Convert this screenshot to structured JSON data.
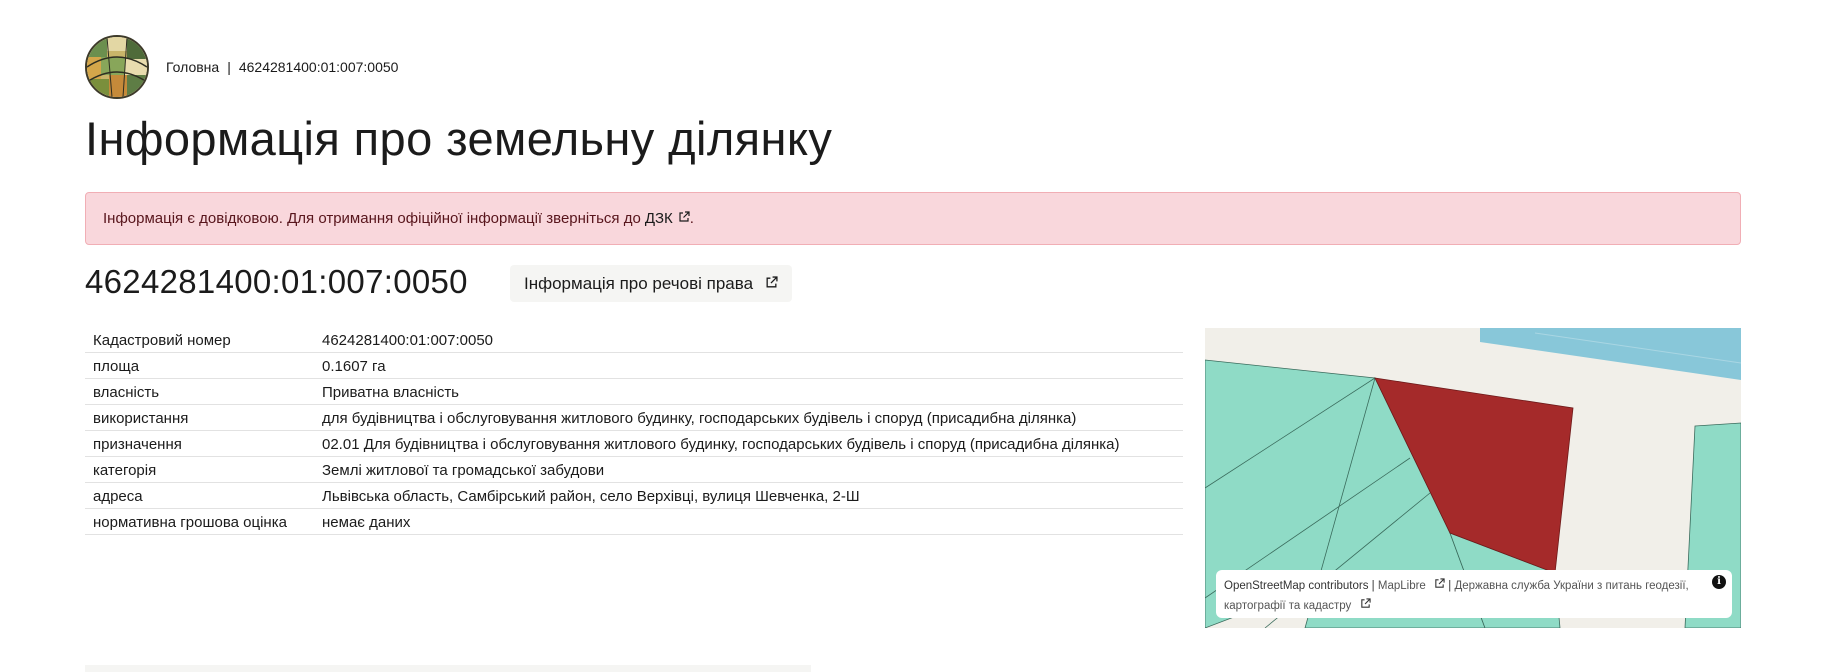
{
  "breadcrumb": {
    "home": "Головна",
    "separator": "|",
    "current": "4624281400:01:007:0050"
  },
  "page_title": "Інформація про земельну ділянку",
  "alert": {
    "text": "Інформація є довідковою. Для отримання офіційної інформації зверніться до",
    "link": "ДЗК",
    "suffix": "."
  },
  "parcel": {
    "number": "4624281400:01:007:0050",
    "rights_button": "Інформація про речові права"
  },
  "table": [
    {
      "label": "Кадастровий номер",
      "value": "4624281400:01:007:0050"
    },
    {
      "label": "площа",
      "value": "0.1607 га"
    },
    {
      "label": "власність",
      "value": "Приватна власність"
    },
    {
      "label": "використання",
      "value": "для будівництва і обслуговування житлового будинку, господарських будівель і споруд (присадибна ділянка)"
    },
    {
      "label": "призначення",
      "value": "02.01 Для будівництва і обслуговування житлового будинку, господарських будівель і споруд (присадибна ділянка)"
    },
    {
      "label": "категорія",
      "value": "Землі житлової та громадської забудови"
    },
    {
      "label": "адреса",
      "value": "Львівська область, Самбірський район, село Верхівці, вулиця Шевченка, 2-Ш"
    },
    {
      "label": "нормативна грошова оцінка",
      "value": "немає даних"
    }
  ],
  "map": {
    "attribution_osm": "OpenStreetMap contributors",
    "attribution_sep": "|",
    "attribution_maplibre": "MapLibre",
    "attribution_sep2": "|",
    "attribution_gov": "Державна служба України з питань геодезії, картографії та кадастру",
    "info_glyph": "i",
    "colors": {
      "parcel": "#a52a2a",
      "neighbors": "#8fdbc6",
      "water": "#88c7d9",
      "land": "#f1efe9"
    }
  }
}
